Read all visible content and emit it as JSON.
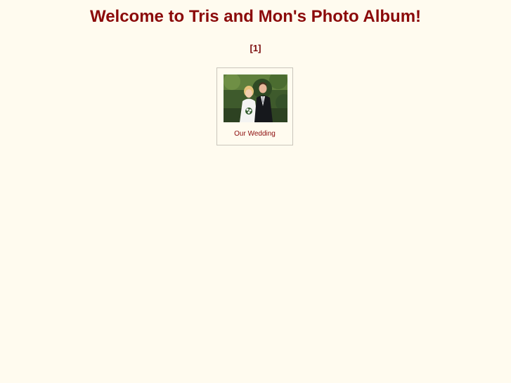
{
  "page": {
    "title": "Welcome to Tris and Mon's Photo Album!"
  },
  "pager": {
    "open": "[",
    "current": "1",
    "close": "]"
  },
  "albums": [
    {
      "caption": "Our Wedding",
      "thumbnail_alt": "Our Wedding"
    }
  ],
  "colors": {
    "background": "#fffbef",
    "accent": "#8b0a0a",
    "card_border": "#c9c5bb"
  }
}
